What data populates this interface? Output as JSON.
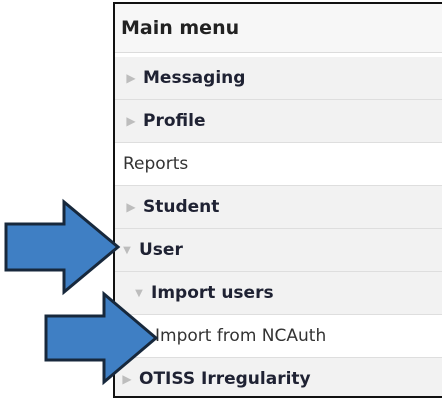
{
  "menu": {
    "title": "Main menu",
    "items": [
      {
        "label": "Messaging",
        "expanded": false
      },
      {
        "label": "Profile",
        "expanded": false
      },
      {
        "label": "Reports"
      },
      {
        "label": "Student",
        "expanded": false
      },
      {
        "label": "User",
        "expanded": true
      },
      {
        "label": "Import users",
        "expanded": true
      },
      {
        "label": "Import from NCAuth"
      },
      {
        "label": "OTISS Irregularity",
        "expanded": false
      }
    ]
  },
  "colors": {
    "arrow_fill": "#3f7fc4",
    "arrow_stroke": "#17283c",
    "row_shade": "#f2f2f2",
    "caret": "#bdbdbd"
  },
  "icons": {
    "collapsed": "right-pointing triangle",
    "expanded": "down-pointing triangle",
    "pointer": "right arrow"
  }
}
